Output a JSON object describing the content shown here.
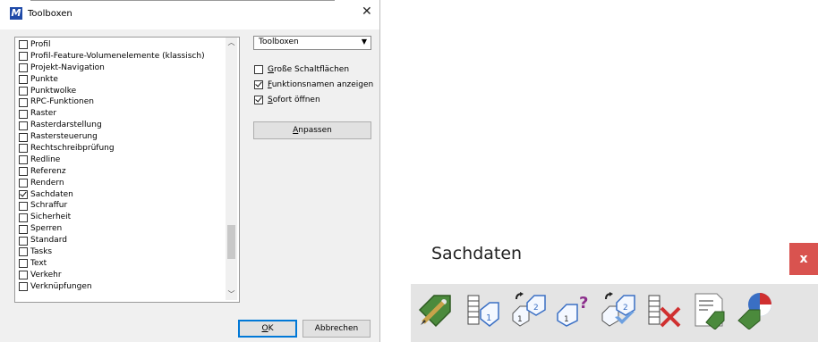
{
  "dialog": {
    "title": "Toolboxen",
    "list": [
      {
        "label": "Profil",
        "checked": false
      },
      {
        "label": "Profil-Feature-Volumenelemente (klassisch)",
        "checked": false
      },
      {
        "label": "Projekt-Navigation",
        "checked": false
      },
      {
        "label": "Punkte",
        "checked": false
      },
      {
        "label": "Punktwolke",
        "checked": false
      },
      {
        "label": "RPC-Funktionen",
        "checked": false
      },
      {
        "label": "Raster",
        "checked": false
      },
      {
        "label": "Rasterdarstellung",
        "checked": false
      },
      {
        "label": "Rastersteuerung",
        "checked": false
      },
      {
        "label": "Rechtschreibprüfung",
        "checked": false
      },
      {
        "label": "Redline",
        "checked": false
      },
      {
        "label": "Referenz",
        "checked": false
      },
      {
        "label": "Rendern",
        "checked": false
      },
      {
        "label": "Sachdaten",
        "checked": true
      },
      {
        "label": "Schraffur",
        "checked": false
      },
      {
        "label": "Sicherheit",
        "checked": false
      },
      {
        "label": "Sperren",
        "checked": false
      },
      {
        "label": "Standard",
        "checked": false
      },
      {
        "label": "Tasks",
        "checked": false
      },
      {
        "label": "Text",
        "checked": false
      },
      {
        "label": "Verkehr",
        "checked": false
      },
      {
        "label": "Verknüpfungen",
        "checked": false
      }
    ],
    "select_value": "Toolboxen",
    "options": {
      "large_buttons": {
        "label": "Große Schaltflächen",
        "checked": false
      },
      "show_names": {
        "label": "Funktionsnamen anzeigen",
        "checked": true
      },
      "open_immediately": {
        "label": "Sofort öffnen",
        "checked": true
      }
    },
    "customize_label": "Anpassen",
    "ok_label": "OK",
    "cancel_label": "Abbrechen"
  },
  "toolbox": {
    "title": "Sachdaten",
    "close_label": "x",
    "tools": [
      "attach-item-icon",
      "item-list-icon",
      "copy-item-icon",
      "query-item-icon",
      "transfer-item-icon",
      "detach-item-icon",
      "report-icon",
      "item-browser-icon"
    ]
  }
}
